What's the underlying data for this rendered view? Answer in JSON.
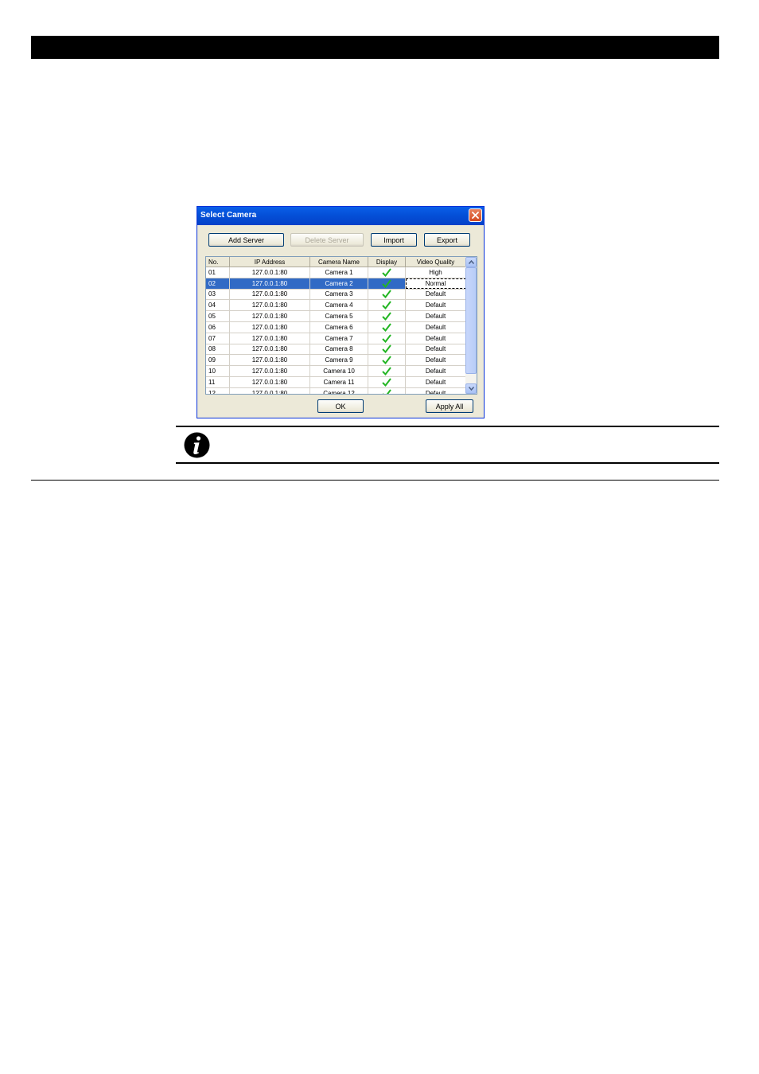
{
  "dialog": {
    "title": "Select Camera",
    "buttons": {
      "add_server": "Add Server",
      "delete_server": "Delete Server",
      "import": "Import",
      "export": "Export",
      "ok": "OK",
      "apply_all": "Apply All"
    },
    "columns": [
      "No.",
      "IP Address",
      "Camera Name",
      "Display",
      "Video Quality"
    ],
    "rows": [
      {
        "no": "01",
        "ip": "127.0.0.1:80",
        "name": "Camera 1",
        "quality": "High"
      },
      {
        "no": "02",
        "ip": "127.0.0.1:80",
        "name": "Camera 2",
        "quality": "Normal"
      },
      {
        "no": "03",
        "ip": "127.0.0.1:80",
        "name": "Camera 3",
        "quality": "Default"
      },
      {
        "no": "04",
        "ip": "127.0.0.1:80",
        "name": "Camera 4",
        "quality": "Default"
      },
      {
        "no": "05",
        "ip": "127.0.0.1:80",
        "name": "Camera 5",
        "quality": "Default"
      },
      {
        "no": "06",
        "ip": "127.0.0.1:80",
        "name": "Camera 6",
        "quality": "Default"
      },
      {
        "no": "07",
        "ip": "127.0.0.1:80",
        "name": "Camera 7",
        "quality": "Default"
      },
      {
        "no": "08",
        "ip": "127.0.0.1:80",
        "name": "Camera 8",
        "quality": "Default"
      },
      {
        "no": "09",
        "ip": "127.0.0.1:80",
        "name": "Camera 9",
        "quality": "Default"
      },
      {
        "no": "10",
        "ip": "127.0.0.1:80",
        "name": "Camera 10",
        "quality": "Default"
      },
      {
        "no": "11",
        "ip": "127.0.0.1:80",
        "name": "Camera 11",
        "quality": "Default"
      },
      {
        "no": "12",
        "ip": "127.0.0.1:80",
        "name": "Camera 12",
        "quality": "Default"
      }
    ],
    "selected_row": 1,
    "display_icon": "checkmark-icon",
    "check_color": "#22b522",
    "selection_color": "#316ac5"
  },
  "note": {
    "icon": "info-icon"
  }
}
